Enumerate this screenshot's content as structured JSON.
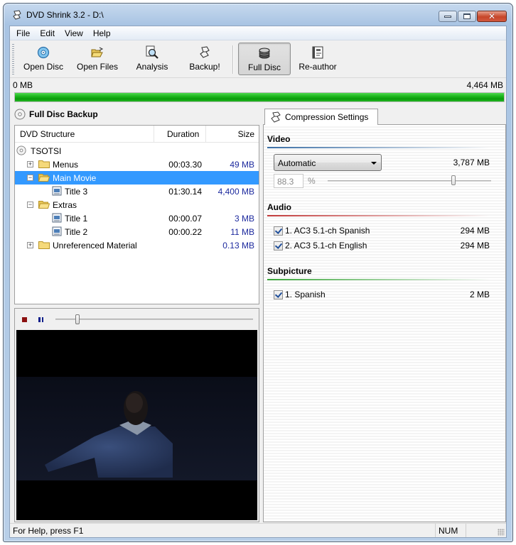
{
  "window": {
    "title": "DVD Shrink 3.2 - D:\\",
    "icon": "dvd-shrink-icon"
  },
  "menu": [
    "File",
    "Edit",
    "View",
    "Help"
  ],
  "toolbar": {
    "buttons": [
      {
        "label": "Open Disc",
        "icon": "disc-icon"
      },
      {
        "label": "Open Files",
        "icon": "open-folder-icon"
      },
      {
        "label": "Analysis",
        "icon": "analysis-magnifier-icon"
      },
      {
        "label": "Backup!",
        "icon": "backup-icon"
      },
      {
        "label": "Full Disc",
        "icon": "disc-stack-icon",
        "active": true
      },
      {
        "label": "Re-author",
        "icon": "film-strip-icon"
      }
    ]
  },
  "progress": {
    "min_label": "0 MB",
    "max_label": "4,464 MB",
    "fill_percent": 100,
    "color": "#1db61d"
  },
  "left_panel": {
    "header": "Full Disc Backup",
    "columns": [
      "DVD Structure",
      "Duration",
      "Size"
    ],
    "tree": [
      {
        "name": "TSOTSI",
        "type": "disc",
        "level": 0,
        "duration": "",
        "size": ""
      },
      {
        "name": "Menus",
        "type": "folder",
        "level": 1,
        "expander": "+",
        "duration": "00:03.30",
        "size": "49 MB"
      },
      {
        "name": "Main Movie",
        "type": "folder-open",
        "level": 1,
        "expander": "-",
        "duration": "",
        "size": "",
        "selected": true
      },
      {
        "name": "Title 3",
        "type": "title",
        "level": 2,
        "duration": "01:30.14",
        "size": "4,400 MB"
      },
      {
        "name": "Extras",
        "type": "folder-open",
        "level": 1,
        "expander": "-",
        "duration": "",
        "size": ""
      },
      {
        "name": "Title 1",
        "type": "title",
        "level": 2,
        "duration": "00:00.07",
        "size": "3 MB"
      },
      {
        "name": "Title 2",
        "type": "title",
        "level": 2,
        "duration": "00:00.22",
        "size": "11 MB"
      },
      {
        "name": "Unreferenced Material",
        "type": "folder",
        "level": 1,
        "expander": "+",
        "duration": "",
        "size": "0.13 MB"
      }
    ]
  },
  "player": {
    "seek_fraction": 0.11,
    "preview_description": "Night scene: boy in blue sweater with arms outstretched"
  },
  "compression": {
    "tab_label": "Compression Settings",
    "video": {
      "title": "Video",
      "mode": "Automatic",
      "size": "3,787 MB",
      "percent": "88.3",
      "percent_sign": "%",
      "slider_fraction": 0.77,
      "line_color": "#3a6ea5"
    },
    "audio": {
      "title": "Audio",
      "line_color": "#c23a3a",
      "tracks": [
        {
          "label": "1. AC3 5.1-ch Spanish",
          "size": "294 MB",
          "checked": true
        },
        {
          "label": "2. AC3 5.1-ch English",
          "size": "294 MB",
          "checked": true
        }
      ]
    },
    "subpicture": {
      "title": "Subpicture",
      "line_color": "#3aa53a",
      "tracks": [
        {
          "label": "1. Spanish",
          "size": "2 MB",
          "checked": true
        }
      ]
    }
  },
  "statusbar": {
    "help_text": "For Help, press F1",
    "num_indicator": "NUM"
  }
}
